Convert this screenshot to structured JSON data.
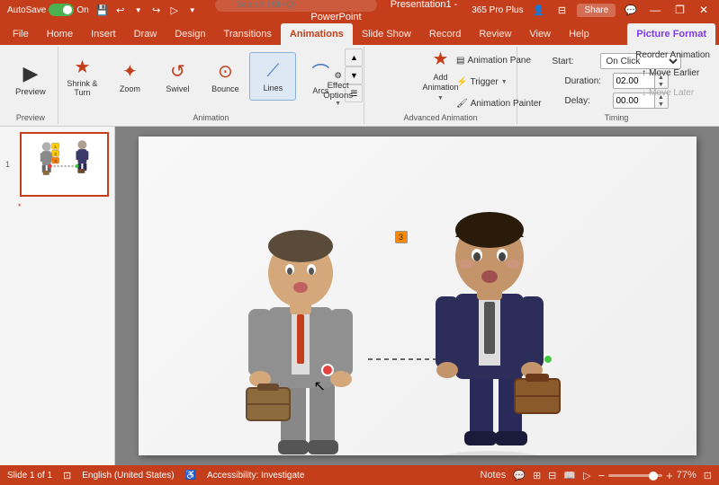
{
  "titlebar": {
    "autosave_label": "AutoSave",
    "autosave_state": "On",
    "filename": "Presentation1 - PowerPoint",
    "search_placeholder": "Search (Alt+Q)",
    "user_label": "365 Pro Plus",
    "share_label": "Share",
    "window_btns": [
      "—",
      "❐",
      "✕"
    ]
  },
  "tabs": [
    {
      "id": "file",
      "label": "File"
    },
    {
      "id": "home",
      "label": "Home"
    },
    {
      "id": "insert",
      "label": "Insert"
    },
    {
      "id": "draw",
      "label": "Draw"
    },
    {
      "id": "design",
      "label": "Design"
    },
    {
      "id": "transitions",
      "label": "Transitions"
    },
    {
      "id": "animations",
      "label": "Animations",
      "active": true
    },
    {
      "id": "slideshow",
      "label": "Slide Show"
    },
    {
      "id": "record",
      "label": "Record"
    },
    {
      "id": "review",
      "label": "Review"
    },
    {
      "id": "view",
      "label": "View"
    },
    {
      "id": "help",
      "label": "Help"
    },
    {
      "id": "picture-format",
      "label": "Picture Format",
      "special": true
    }
  ],
  "ribbon": {
    "preview_group": {
      "label": "Preview",
      "preview_btn": "Preview"
    },
    "animation_group": {
      "label": "Animation",
      "items": [
        {
          "id": "shrink-turn",
          "label": "Shrink & Turn",
          "icon": "★"
        },
        {
          "id": "zoom",
          "label": "Zoom",
          "icon": "✦"
        },
        {
          "id": "swivel",
          "label": "Swivel",
          "icon": "↺"
        },
        {
          "id": "bounce",
          "label": "Bounce",
          "icon": "⊙"
        },
        {
          "id": "lines",
          "label": "Lines",
          "icon": "⟋",
          "active": true
        },
        {
          "id": "arcs",
          "label": "Arcs",
          "icon": "⌒"
        }
      ],
      "effect_options": "Effect\nOptions",
      "expand_icon": "▼"
    },
    "advanced_group": {
      "label": "Advanced Animation",
      "animation_pane": "Animation Pane",
      "trigger": "Trigger",
      "animation_painter": "Animation Painter",
      "add_animation": "Add\nAnimation"
    },
    "timing_group": {
      "label": "Timing",
      "start_label": "Start:",
      "start_value": "On Click",
      "duration_label": "Duration:",
      "duration_value": "02.00",
      "delay_label": "Delay:",
      "delay_value": "00.00",
      "reorder_label": "Reorder Animation",
      "move_earlier": "Move Earlier",
      "move_later": "Move Later"
    }
  },
  "slide": {
    "number": "1",
    "star_label": "*"
  },
  "status_bar": {
    "slide_info": "Slide 1 of 1",
    "language": "English (United States)",
    "accessibility": "Accessibility: Investigate",
    "notes_label": "Notes",
    "zoom_level": "77%"
  },
  "animation_badges": [
    "1",
    "2",
    "3"
  ]
}
